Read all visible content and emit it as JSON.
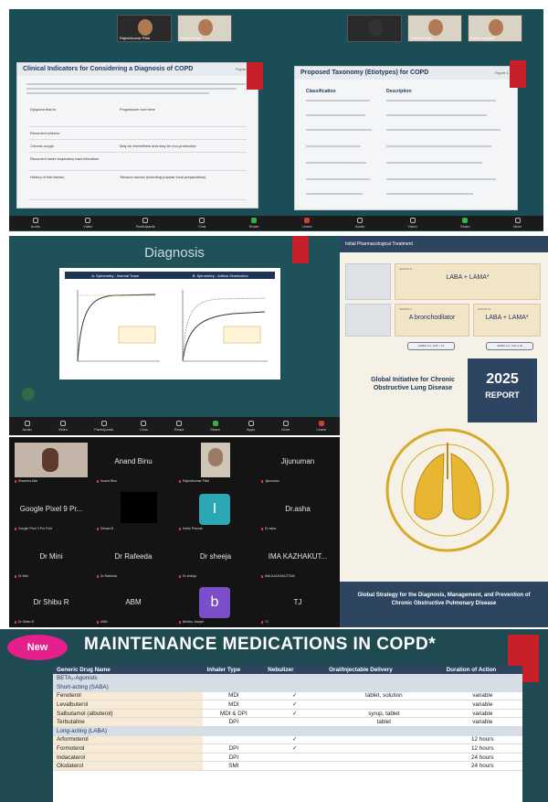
{
  "panel1": {
    "top_tiles_left": [
      {
        "name": "Rajeshkumar Pillai"
      },
      {
        "name": "Shaeeba Nair"
      }
    ],
    "top_tiles_right": [
      {
        "name": ""
      },
      {
        "name": "Shaeeba Nair"
      },
      {
        "name": "Kailas Vasanth"
      }
    ],
    "slide_left": {
      "title": "Clinical Indicators for Considering a Diagnosis of COPD",
      "label": "Figure 2.1",
      "rows": [
        {
          "k": "Dyspnea that is:",
          "v": "Progressive over time"
        },
        {
          "k": "Recurrent wheeze",
          "v": ""
        },
        {
          "k": "Chronic cough",
          "v": "May be intermittent and may be non-productive"
        },
        {
          "k": "Recurrent lower respiratory tract infections",
          "v": ""
        },
        {
          "k": "History of risk factors",
          "v": "Tobacco smoke (including popular local preparations)"
        }
      ]
    },
    "slide_right": {
      "title": "Proposed Taxonomy (Etiotypes) for COPD",
      "label": "Figure 1.1",
      "col1": "Classification",
      "col2": "Description"
    }
  },
  "diagnosis": {
    "title": "Diagnosis",
    "chart_a": "A: Spirometry - Normal Trace",
    "chart_b": "B: Spirometry - Airflow Obstruction"
  },
  "gold": {
    "header": "Initial Pharmacological Treatment",
    "groupE_label": "GROUP E",
    "groupE_text": "LABA + LAMA*",
    "groupA_label": "GROUP A",
    "groupA_text": "A bronchodilator",
    "groupB_label": "GROUP B",
    "groupB_text": "LABA + LAMA*",
    "pill_a": "mMRC 0-1, CAT < 10",
    "pill_b": "mMRC ≥ 2, CAT ≥ 10",
    "initiative": "Global Initiative for Chronic Obstructive Lung Disease",
    "year": "2025",
    "report": "REPORT",
    "strategy": "Global Strategy for the Diagnosis, Management, and Prevention of Chronic Obstructive Pulmonary Disease"
  },
  "participants": [
    {
      "name": "",
      "label": "Shaeeba Nair",
      "kind": "video"
    },
    {
      "name": "Anand Binu",
      "label": "Anand Binu",
      "kind": "name"
    },
    {
      "name": "",
      "label": "Rajeshkumar Pillai",
      "kind": "video2"
    },
    {
      "name": "Jijunuman",
      "label": "Jijunuman",
      "kind": "name"
    },
    {
      "name": "Google Pixel 9 Pr...",
      "label": "Google Pixel 9 Pro Fold",
      "kind": "name"
    },
    {
      "name": "",
      "label": "Dewas B",
      "kind": "black"
    },
    {
      "name": "I",
      "label": "Indira Premak",
      "kind": "avatar",
      "color": "#2aa7b3"
    },
    {
      "name": "Dr.asha",
      "label": "Dr asha",
      "kind": "name"
    },
    {
      "name": "Dr Mini",
      "label": "Dr Mini",
      "kind": "name"
    },
    {
      "name": "Dr Rafeeda",
      "label": "Dr Rafeeda",
      "kind": "name"
    },
    {
      "name": "Dr sheeja",
      "label": "Dr sheeja",
      "kind": "name"
    },
    {
      "name": "IMA KAZHAKUT...",
      "label": "IMA KAZHAKUTTAM",
      "kind": "name"
    },
    {
      "name": "Dr Shibu R",
      "label": "Dr Shibu R",
      "kind": "name"
    },
    {
      "name": "ABM",
      "label": "ABM",
      "kind": "name"
    },
    {
      "name": "b",
      "label": "Bindhu Joseph",
      "kind": "avatar",
      "color": "#7b4fc9"
    },
    {
      "name": "TJ",
      "label": "TJ",
      "kind": "name"
    }
  ],
  "toolbar": [
    "Audio",
    "Video",
    "Participants",
    "Chat",
    "React",
    "Share",
    "Apps",
    "More",
    "Leave"
  ],
  "maintenance": {
    "badge": "New",
    "title": "MAINTENANCE MEDICATIONS IN COPD*",
    "headers": [
      "Generic Drug Name",
      "Inhaler Type",
      "Nebulizer",
      "Oral/Injectable Delivery",
      "Duration of Action"
    ],
    "rows": [
      {
        "section": "BETA₂-Agonists"
      },
      {
        "section": "Short-acting (SABA)"
      },
      {
        "drug": "Fenoterol",
        "inhaler": "MDI",
        "neb": "✓",
        "oral": "tablet, solution",
        "dur": "variable"
      },
      {
        "drug": "Levalbuterol",
        "inhaler": "MDI",
        "neb": "✓",
        "oral": "",
        "dur": "variable"
      },
      {
        "drug": "Salbutamol (albuterol)",
        "inhaler": "MDI & DPI",
        "neb": "✓",
        "oral": "syrup, tablet",
        "dur": "variable"
      },
      {
        "drug": "Terbutaline",
        "inhaler": "DPI",
        "neb": "",
        "oral": "tablet",
        "dur": "variable"
      },
      {
        "section": "Long-acting (LABA)"
      },
      {
        "drug": "Arformoterol",
        "inhaler": "",
        "neb": "✓",
        "oral": "",
        "dur": "12 hours"
      },
      {
        "drug": "Formoterol",
        "inhaler": "DPI",
        "neb": "✓",
        "oral": "",
        "dur": "12 hours"
      },
      {
        "drug": "Indacaterol",
        "inhaler": "DPI",
        "neb": "",
        "oral": "",
        "dur": "24 hours"
      },
      {
        "drug": "Olodaterol",
        "inhaler": "SMI",
        "neb": "",
        "oral": "",
        "dur": "24 hours"
      }
    ]
  }
}
